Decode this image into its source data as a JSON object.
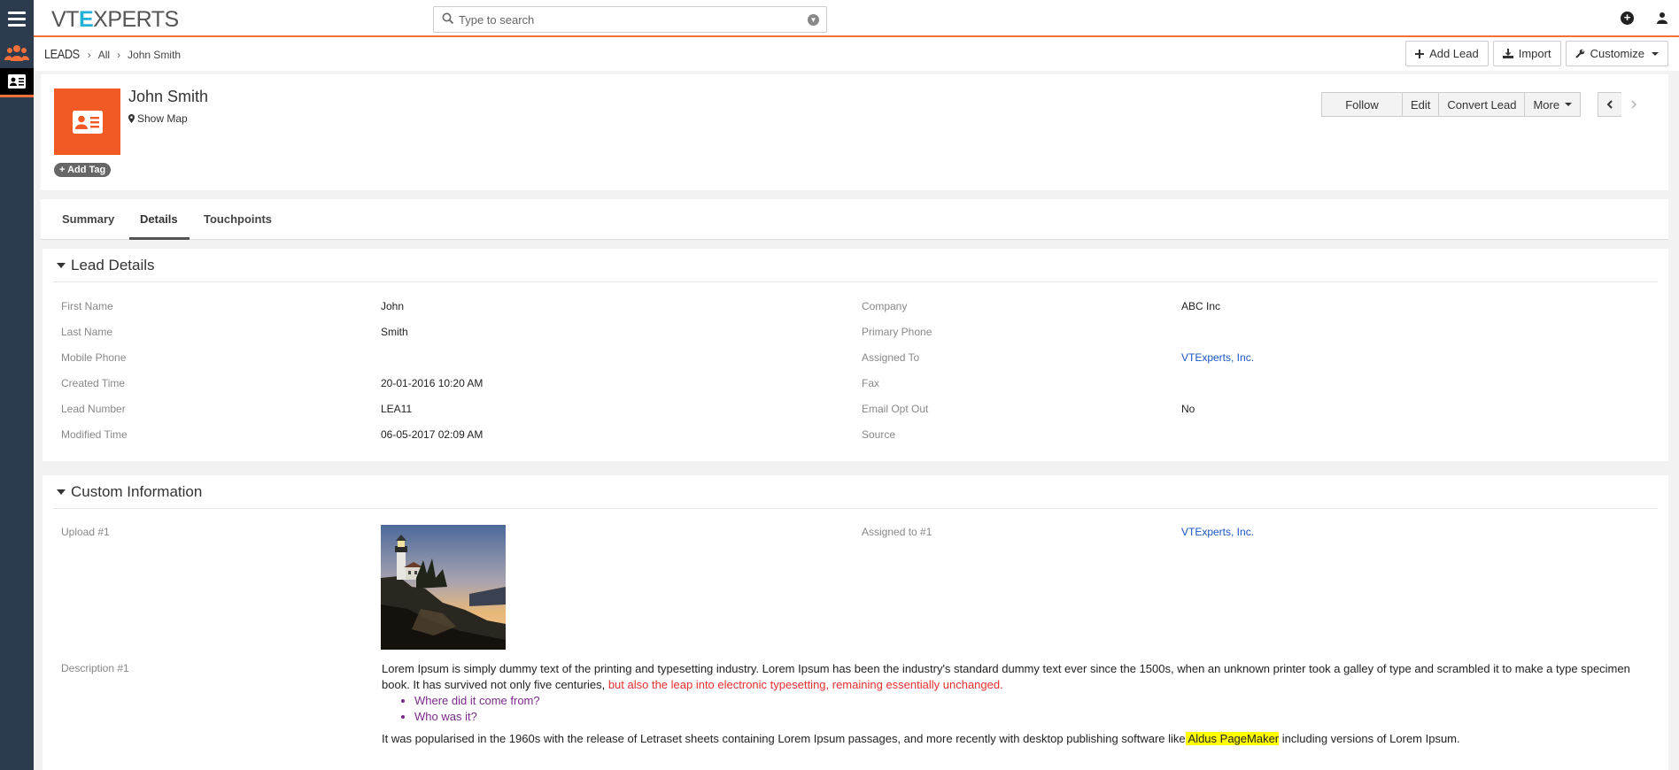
{
  "app": {
    "logo": {
      "pre": "VT",
      "x": "E",
      "post": "XPERTS"
    },
    "search": {
      "placeholder": "Type to search"
    }
  },
  "breadcrumb": {
    "module": "LEADS",
    "list": "All",
    "record": "John Smith"
  },
  "header_buttons": {
    "add_lead": "Add Lead",
    "import": "Import",
    "customize": "Customize"
  },
  "record": {
    "name": "John Smith",
    "show_map": "Show Map",
    "add_tag": "Add Tag",
    "actions": {
      "follow": "Follow",
      "edit": "Edit",
      "convert": "Convert Lead",
      "more": "More"
    }
  },
  "tabs": {
    "summary": "Summary",
    "details": "Details",
    "touchpoints": "Touchpoints"
  },
  "lead_details": {
    "title": "Lead Details",
    "left": [
      {
        "label": "First Name",
        "value": "John"
      },
      {
        "label": "Last Name",
        "value": "Smith"
      },
      {
        "label": "Mobile Phone",
        "value": ""
      },
      {
        "label": "Created Time",
        "value": "20-01-2016 10:20 AM"
      },
      {
        "label": "Lead Number",
        "value": "LEA11"
      },
      {
        "label": "Modified Time",
        "value": "06-05-2017 02:09 AM"
      }
    ],
    "right": [
      {
        "label": "Company",
        "value": "ABC Inc"
      },
      {
        "label": "Primary Phone",
        "value": ""
      },
      {
        "label": "Assigned To",
        "value": "VTExperts, Inc."
      },
      {
        "label": "Fax",
        "value": ""
      },
      {
        "label": "Email Opt Out",
        "value": "No"
      },
      {
        "label": "Source",
        "value": ""
      }
    ]
  },
  "custom_info": {
    "title": "Custom Information",
    "upload_label": "Upload #1",
    "assigned_label": "Assigned to #1",
    "assigned_value": "VTExperts, Inc.",
    "description_label": "Description #1",
    "description": {
      "p1_black": "Lorem Ipsum is simply dummy text of the printing and typesetting industry. Lorem Ipsum has been the industry's standard dummy text ever since the 1500s, when an unknown printer took a galley of type and scrambled it to make a type specimen book. It has survived not only five centuries, ",
      "p1_red": "but also the leap into electronic typesetting, remaining essentially unchanged.",
      "bullets": [
        "Where did it come from?",
        "Who was it?"
      ],
      "p2_start": "It was popularised in the 1960s with the release of Letraset sheets containing Lorem Ipsum passages, and more recently with desktop publishing software like",
      "p2_highlight": " Aldus PageMaker",
      "p2_end": " including versions of Lorem Ipsum."
    }
  },
  "colors": {
    "accent": "#f4703a",
    "record_icon": "#f15a24",
    "sidebar": "#2c3b4d",
    "link": "#1a55c4"
  }
}
